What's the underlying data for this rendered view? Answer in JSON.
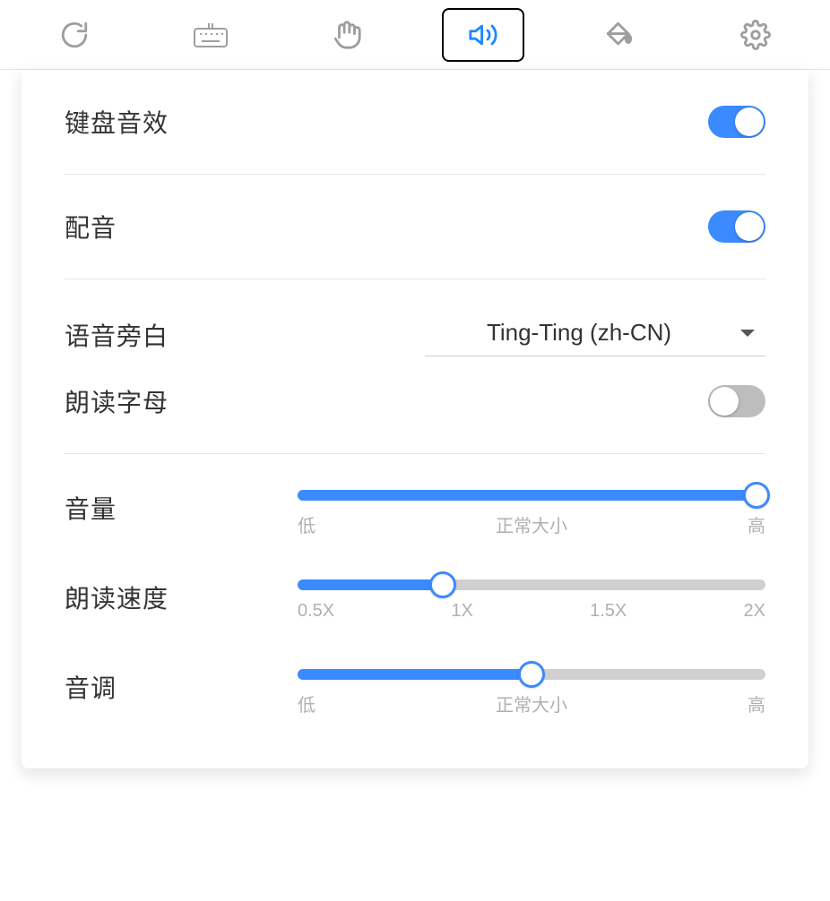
{
  "toolbar": {
    "active_index": 3,
    "icons": [
      "refresh-icon",
      "keyboard-icon",
      "hand-icon",
      "sound-icon",
      "paint-icon",
      "gear-icon"
    ]
  },
  "settings": {
    "keyboard_sounds": {
      "label": "键盘音效",
      "on": true
    },
    "voice_over": {
      "label": "配音",
      "on": true
    },
    "narrator": {
      "label": "语音旁白",
      "value": "Ting-Ting (zh-CN)"
    },
    "read_letters": {
      "label": "朗读字母",
      "on": false
    },
    "volume": {
      "label": "音量",
      "value_pct": 98,
      "ticks": [
        "低",
        "正常大小",
        "高"
      ]
    },
    "speed": {
      "label": "朗读速度",
      "value_pct": 31,
      "ticks": [
        "0.5X",
        "1X",
        "1.5X",
        "2X"
      ]
    },
    "pitch": {
      "label": "音调",
      "value_pct": 50,
      "ticks": [
        "低",
        "正常大小",
        "高"
      ]
    }
  }
}
